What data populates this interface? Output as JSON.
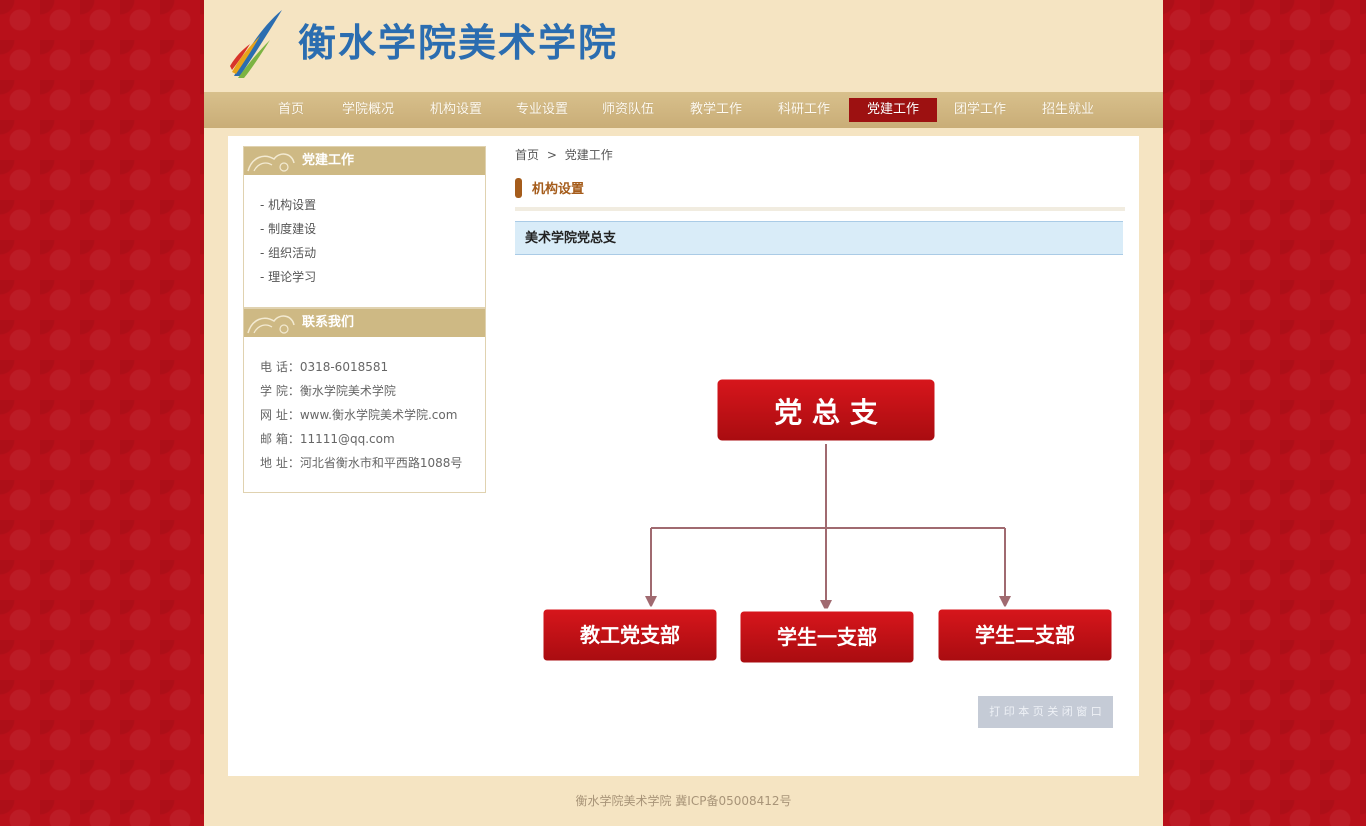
{
  "site": {
    "title": "衡水学院美术学院"
  },
  "nav": [
    {
      "label": "首页"
    },
    {
      "label": "学院概况"
    },
    {
      "label": "机构设置"
    },
    {
      "label": "专业设置"
    },
    {
      "label": "师资队伍"
    },
    {
      "label": "教学工作"
    },
    {
      "label": "科研工作"
    },
    {
      "label": "党建工作",
      "active": true
    },
    {
      "label": "团学工作"
    },
    {
      "label": "招生就业"
    }
  ],
  "sidebar": {
    "menu": {
      "title": "党建工作",
      "items": [
        "- 机构设置",
        "- 制度建设",
        "- 组织活动",
        "- 理论学习"
      ]
    },
    "contact": {
      "title": "联系我们",
      "lines": [
        "电 话：0318-6018581",
        "学 院：衡水学院美术学院",
        "网 址：www.衡水学院美术学院.com",
        "邮 箱：11111@qq.com",
        "地 址：河北省衡水市和平西路1088号"
      ]
    }
  },
  "breadcrumb": {
    "home": "首页",
    "sep": ">",
    "current": "党建工作"
  },
  "section": {
    "title": "机构设置"
  },
  "article": {
    "title": "美术学院党总支"
  },
  "orgchart": {
    "root": "党 总 支",
    "children": [
      "教工党支部",
      "学生一支部",
      "学生二支部"
    ]
  },
  "print": {
    "label": "打 印 本 页    关 闭 窗 口"
  },
  "footer": {
    "text": "衡水学院美术学院 冀ICP备05008412号"
  },
  "colors": {
    "accent": "#9d1111",
    "nav": "#c9ad77",
    "bg": "#b8101a"
  }
}
